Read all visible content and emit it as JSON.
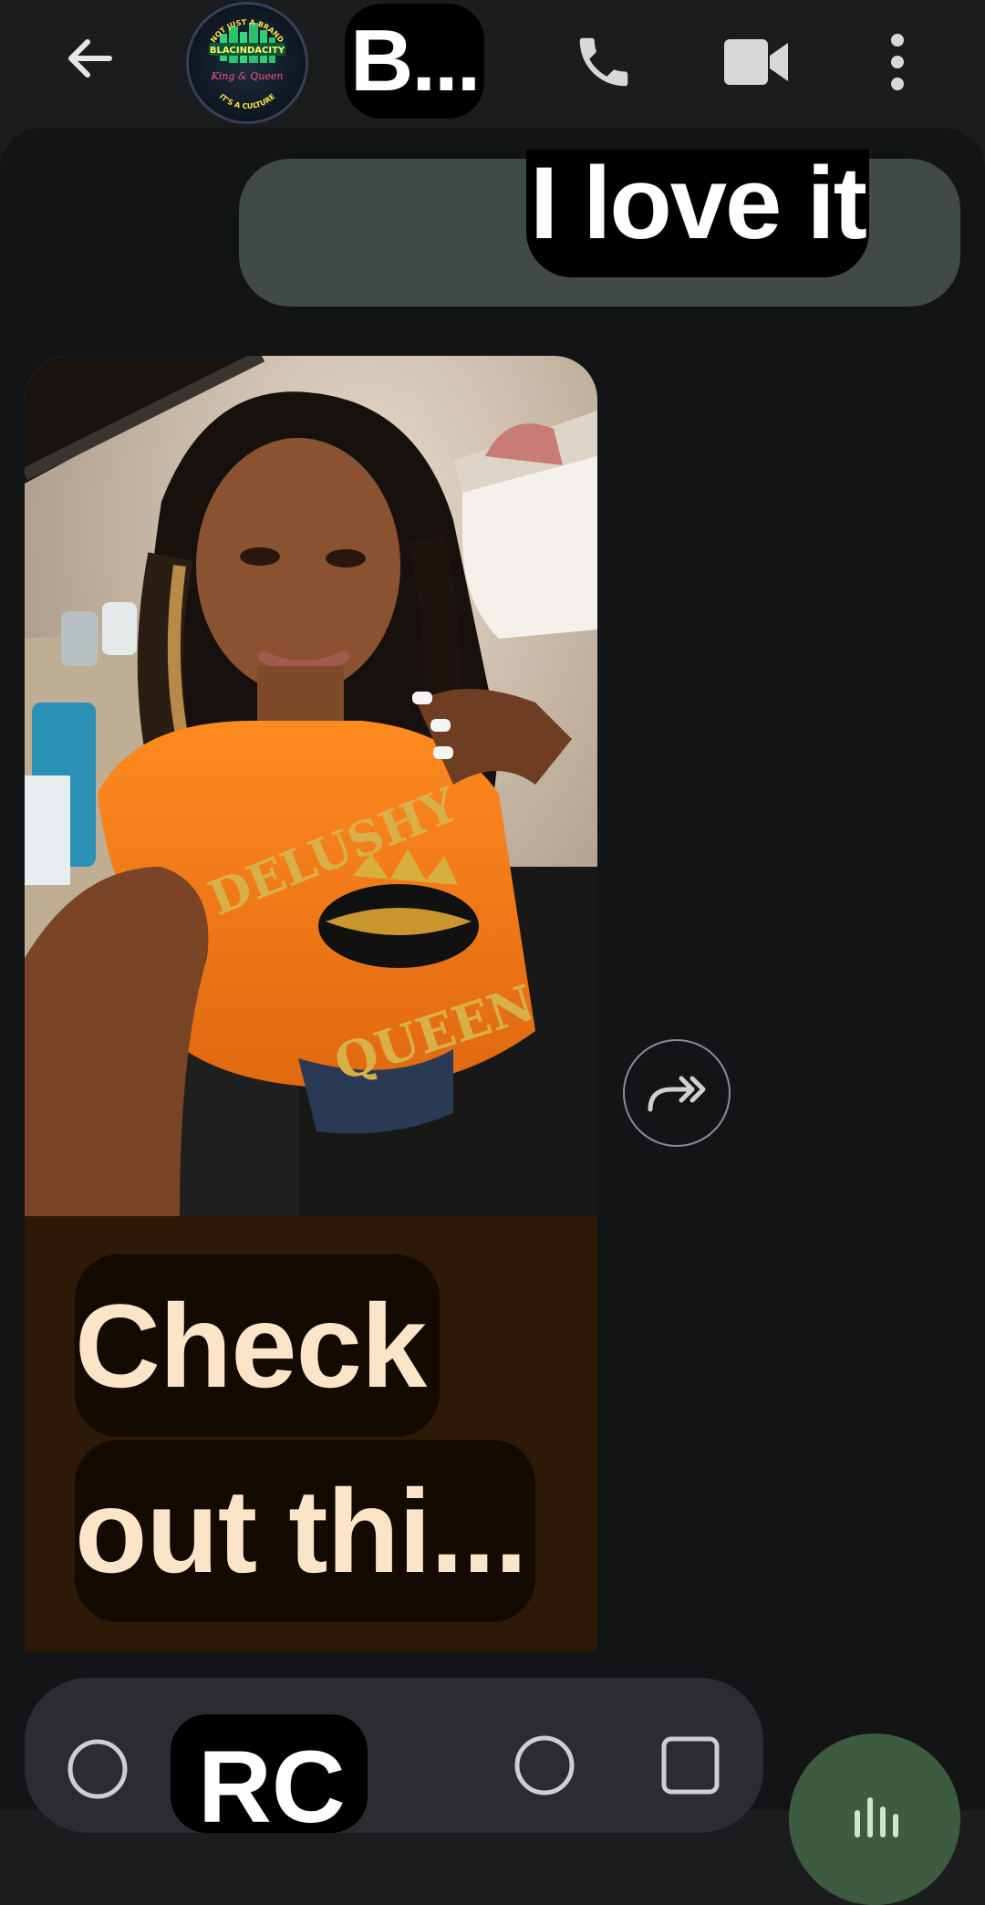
{
  "header": {
    "contact_name": "B...",
    "avatar_lines": [
      "NOT JUST A BRAND",
      "BLACINDACITY",
      "King & Queen",
      "IT'S A CULTURE"
    ],
    "icons": [
      "back-arrow-icon",
      "phone-icon",
      "video-camera-icon",
      "more-vert-icon"
    ]
  },
  "messages": {
    "sent_text": "I love it",
    "photo_caption_line1": "Check",
    "photo_caption_line2": "out thi...",
    "shirt_text_top": "DELUSHY",
    "shirt_text_bottom": "QUEEN"
  },
  "composer": {
    "text": "RC",
    "icons": [
      "add-icon",
      "emoji-icon",
      "gallery-icon",
      "voice-icon"
    ]
  },
  "colors": {
    "background": "#131416",
    "header": "#1b1c1e",
    "sent_bubble": "#414a48",
    "caption_bg": "#2e1806",
    "caption_text": "#fce4c8",
    "mic_button": "#3d5b3f"
  }
}
